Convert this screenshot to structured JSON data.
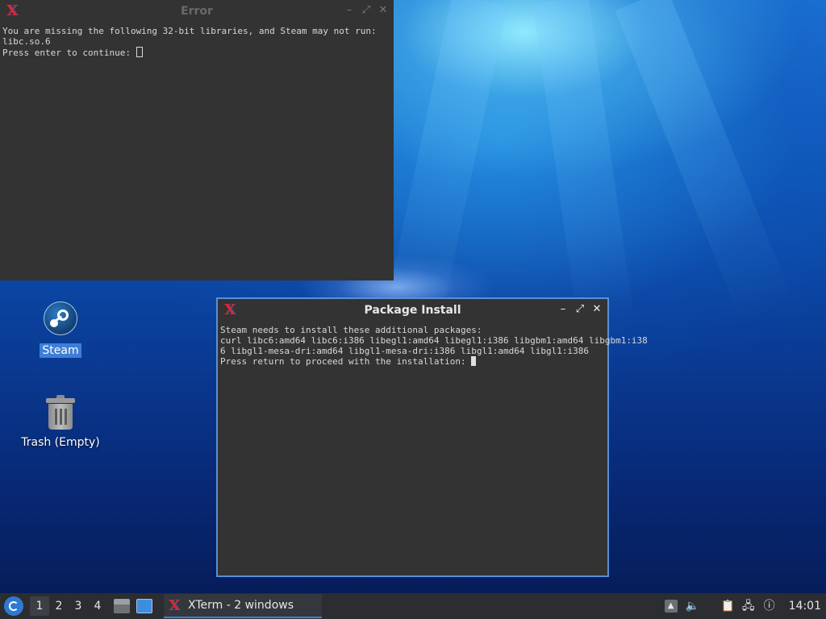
{
  "desktop": {
    "icons": [
      {
        "label": "Steam",
        "icon": "steam-icon",
        "selected": true
      },
      {
        "label": "Trash (Empty)",
        "icon": "trash-icon",
        "selected": false
      }
    ]
  },
  "windows": {
    "error": {
      "title": "Error",
      "lines": [
        "You are missing the following 32-bit libraries, and Steam may not run:",
        "libc.so.6",
        "Press enter to continue: "
      ]
    },
    "package_install": {
      "title": "Package Install",
      "lines": [
        "",
        "Steam needs to install these additional packages:",
        "curl libc6:amd64 libc6:i386 libegl1:amd64 libegl1:i386 libgbm1:amd64 libgbm1:i38",
        "6 libgl1-mesa-dri:amd64 libgl1-mesa-dri:i386 libgl1:amd64 libgl1:i386",
        "",
        "Press return to proceed with the installation: "
      ]
    }
  },
  "taskbar": {
    "workspaces": [
      "1",
      "2",
      "3",
      "4"
    ],
    "active_workspace": "1",
    "task_label": "XTerm - 2 windows",
    "clock": "14:01"
  },
  "colors": {
    "accent": "#3d7fd6",
    "terminal_bg": "#333333",
    "xterm_red": "#d9272e"
  }
}
